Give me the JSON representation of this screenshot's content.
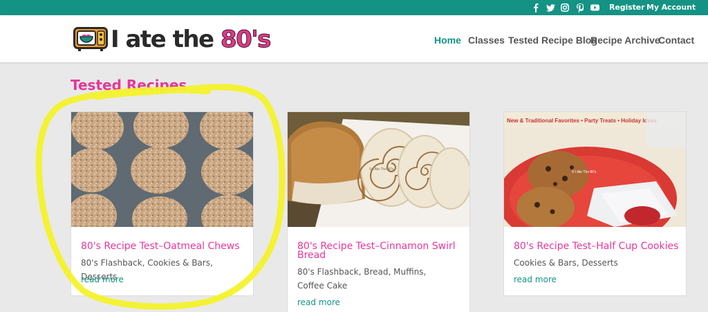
{
  "topbar": {
    "social_icons": [
      "facebook-icon",
      "twitter-icon",
      "instagram-icon",
      "pinterest-icon",
      "youtube-icon"
    ],
    "register_label": "Register",
    "account_label": "My Account"
  },
  "header": {
    "logo_text": "I ate the",
    "logo_highlight": "80's",
    "nav": [
      {
        "label": "Home",
        "active": true
      },
      {
        "label": "Classes",
        "active": false
      },
      {
        "label": "Tested Recipe Blog",
        "active": false
      },
      {
        "label": "Recipe Archive",
        "active": false
      },
      {
        "label": "Contact",
        "active": false
      }
    ]
  },
  "main": {
    "section_title": "Tested Recipes",
    "cards": [
      {
        "title": "80's Recipe Test–Oatmeal Chews",
        "categories": "80's Flashback, Cookies & Bars, Desserts",
        "read_more": "read more"
      },
      {
        "title": "80's Recipe Test–Cinnamon Swirl Bread",
        "categories": "80's Flashback, Bread, Muffins, Coffee Cake",
        "read_more": "read more",
        "watermark": "© I Ate The 80's"
      },
      {
        "title": "80's Recipe Test–Half Cup Cookies",
        "categories": "Cookies & Bars, Desserts",
        "read_more": "read more",
        "image_caption": "New & Traditional Favorites • Party Treats • Holiday Ideas",
        "watermark": "© I Ate The 80's"
      }
    ]
  },
  "colors": {
    "teal": "#149385",
    "pink": "#e6379a",
    "highlight": "#f4f22a"
  }
}
